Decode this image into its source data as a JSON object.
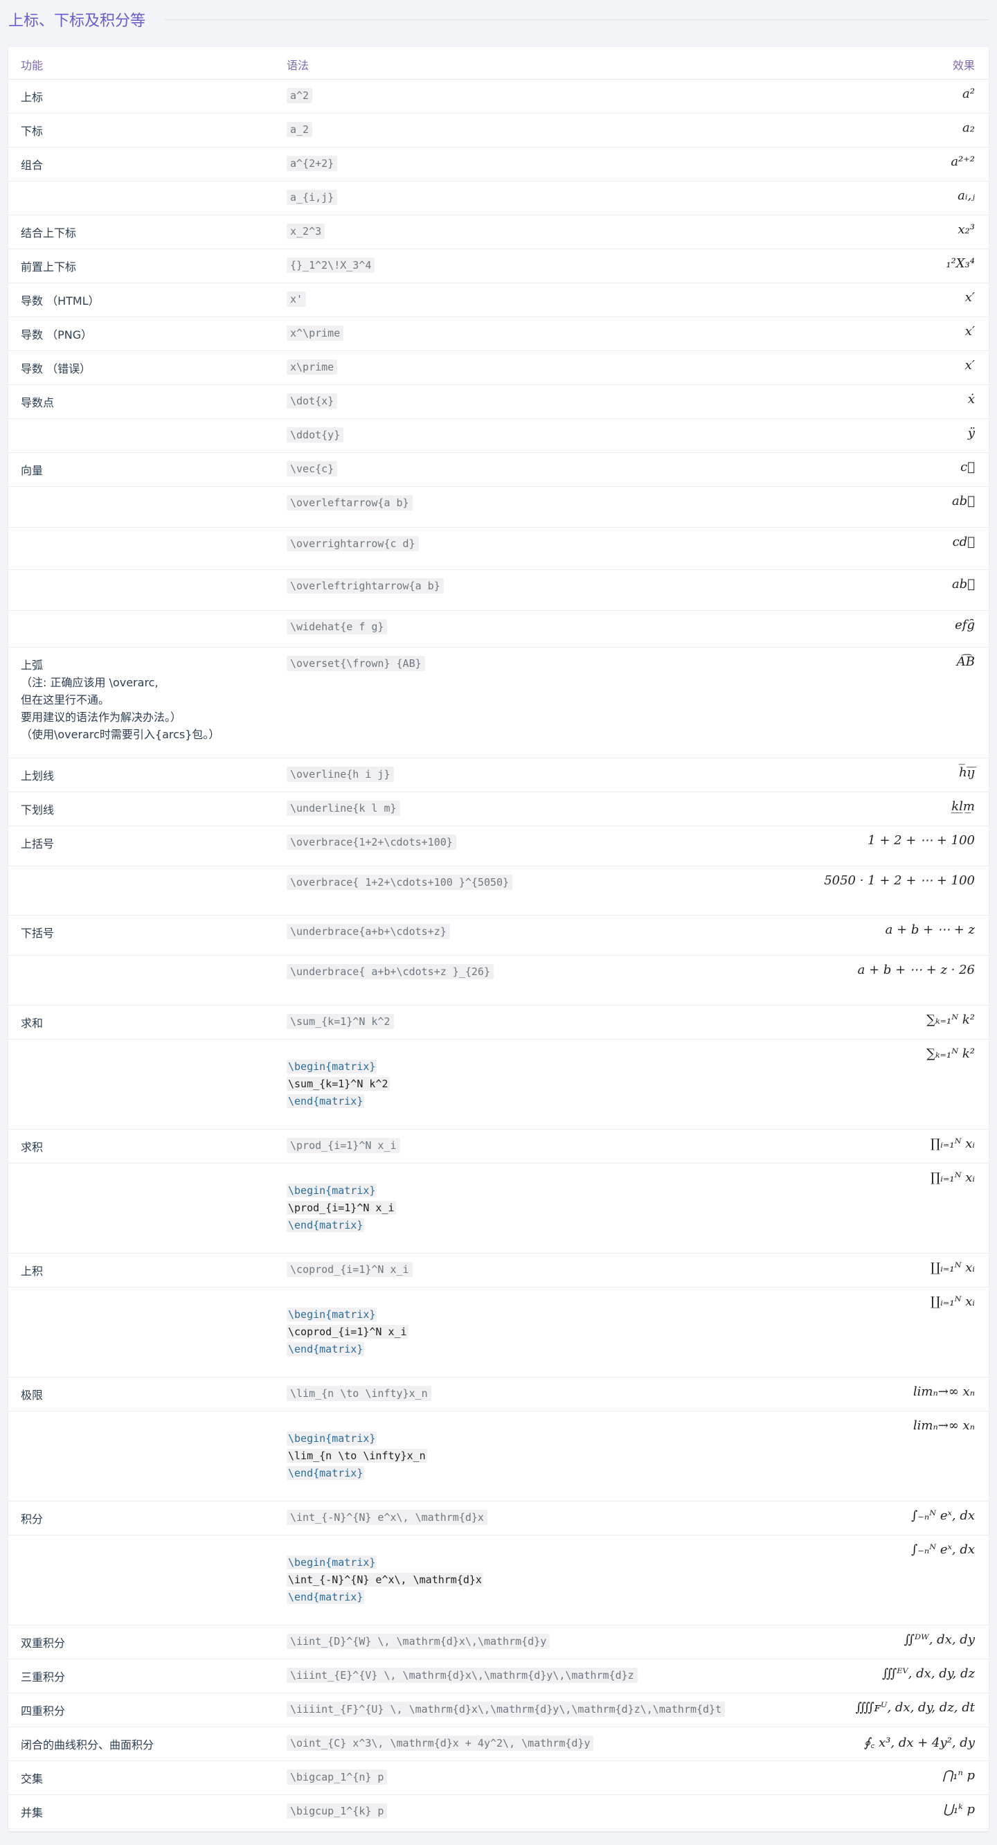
{
  "section_title": "上标、下标及积分等",
  "columns": {
    "feature": "功能",
    "syntax": "语法",
    "effect": "效果"
  },
  "rows": [
    {
      "h": 49,
      "feature": "上标",
      "syntax": "a^2",
      "effect": "a²"
    },
    {
      "h": 49,
      "feature": "下标",
      "syntax": "a_2",
      "effect": "a₂"
    },
    {
      "h": 49,
      "feature": "组合",
      "syntax": "a^{2+2}",
      "effect": "a²⁺²"
    },
    {
      "h": 49,
      "feature": "",
      "syntax": "a_{i,j}",
      "effect": "aᵢ,ⱼ"
    },
    {
      "h": 49,
      "feature": "结合上下标",
      "syntax": "x_2^3",
      "effect": "x₂³"
    },
    {
      "h": 49,
      "feature": "前置上下标",
      "syntax": "{}_1^2\\!X_3^4",
      "effect": "₁²X₃⁴"
    },
    {
      "h": 49,
      "feature": "导数 （HTML）",
      "syntax": "x'",
      "effect": "x′"
    },
    {
      "h": 49,
      "feature": "导数 （PNG）",
      "syntax": "x^\\prime",
      "effect": "x′"
    },
    {
      "h": 49,
      "feature": "导数 （错误）",
      "syntax": "x\\prime",
      "effect": "x′"
    },
    {
      "h": 49,
      "feature": "导数点",
      "syntax": "\\dot{x}",
      "effect": "ẋ"
    },
    {
      "h": 49,
      "feature": "",
      "syntax": "\\ddot{y}",
      "effect": "ÿ"
    },
    {
      "h": 49,
      "feature": "向量",
      "syntax": "\\vec{c}",
      "effect": "c⃗"
    },
    {
      "h": 59,
      "feature": "",
      "syntax": "\\overleftarrow{a b}",
      "effect": "ab⃖"
    },
    {
      "h": 61,
      "feature": "",
      "syntax": "\\overrightarrow{c d}",
      "effect": "cd⃗"
    },
    {
      "h": 59,
      "feature": "",
      "syntax": "\\overleftrightarrow{a b}",
      "effect": "ab⃡"
    },
    {
      "h": 53,
      "feature": "",
      "syntax": "\\widehat{e f g}",
      "effect": "efg̑"
    },
    {
      "h": 160,
      "feature": "上弧\n（注: 正确应该用 \\overarc,\n但在这里行不通。\n要用建议的语法作为解决办法。）\n（使用\\overarc时需要引入{arcs}包。）",
      "syntax": "\\overset{\\frown} {AB}",
      "effect": "A͡B"
    },
    {
      "h": 49,
      "feature": "上划线",
      "syntax": "\\overline{h i j}",
      "effect": "h̅i̅j̅"
    },
    {
      "h": 49,
      "feature": "下划线",
      "syntax": "\\underline{k l m}",
      "effect": "k̲l̲m̲"
    },
    {
      "h": 58,
      "feature": "上括号",
      "syntax": "\\overbrace{1+2+\\cdots+100}",
      "effect": "1 + 2 + ⋯ + 100"
    },
    {
      "h": 71,
      "feature": "",
      "syntax": "\\overbrace{ 1+2+\\cdots+100 }^{5050}",
      "effect": "5050 · 1 + 2 + ⋯ + 100"
    },
    {
      "h": 58,
      "feature": "下括号",
      "syntax": "\\underbrace{a+b+\\cdots+z}",
      "effect": "a + b + ⋯ + z"
    },
    {
      "h": 72,
      "feature": "",
      "syntax": "\\underbrace{ a+b+\\cdots+z }_{26}",
      "effect": "a + b + ⋯ + z · 26"
    },
    {
      "h": 49,
      "feature": "求和",
      "syntax": "\\sum_{k=1}^N k^2",
      "effect": "∑ₖ₌₁ᴺ k²"
    },
    {
      "h": 130,
      "feature": "",
      "syntax_block": [
        "\\begin{matrix}",
        "\\sum_{k=1}^N k^2",
        "\\end{matrix}"
      ],
      "effect": "∑ₖ₌₁ᴺ k²"
    },
    {
      "h": 49,
      "feature": "求积",
      "syntax": "\\prod_{i=1}^N x_i",
      "effect": "∏ᵢ₌₁ᴺ xᵢ"
    },
    {
      "h": 130,
      "feature": "",
      "syntax_block": [
        "\\begin{matrix}",
        "\\prod_{i=1}^N x_i",
        "\\end{matrix}"
      ],
      "effect": "∏ᵢ₌₁ᴺ xᵢ"
    },
    {
      "h": 49,
      "feature": "上积",
      "syntax": "\\coprod_{i=1}^N x_i",
      "effect": "∐ᵢ₌₁ᴺ xᵢ"
    },
    {
      "h": 130,
      "feature": "",
      "syntax_block": [
        "\\begin{matrix}",
        "\\coprod_{i=1}^N x_i",
        "\\end{matrix}"
      ],
      "effect": "∐ᵢ₌₁ᴺ xᵢ"
    },
    {
      "h": 49,
      "feature": "极限",
      "syntax": "\\lim_{n \\to \\infty}x_n",
      "effect": "limₙ→∞ xₙ"
    },
    {
      "h": 130,
      "feature": "",
      "syntax_block": [
        "\\begin{matrix}",
        "\\lim_{n \\to \\infty}x_n",
        "\\end{matrix}"
      ],
      "effect": "limₙ→∞ xₙ"
    },
    {
      "h": 49,
      "feature": "积分",
      "syntax": "\\int_{-N}^{N} e^x\\, \\mathrm{d}x",
      "effect": "∫₋ₙᴺ eˣ, dx"
    },
    {
      "h": 130,
      "feature": "",
      "syntax_block": [
        "\\begin{matrix}",
        "\\int_{-N}^{N} e^x\\, \\mathrm{d}x",
        "\\end{matrix}"
      ],
      "effect": "∫₋ₙᴺ eˣ, dx"
    },
    {
      "h": 49,
      "feature": "双重积分",
      "syntax": "\\iint_{D}^{W} \\, \\mathrm{d}x\\,\\mathrm{d}y",
      "effect": "∬ᴰᵂ, dx, dy"
    },
    {
      "h": 49,
      "feature": "三重积分",
      "syntax": "\\iiint_{E}^{V} \\, \\mathrm{d}x\\,\\mathrm{d}y\\,\\mathrm{d}z",
      "effect": "∭ᴱⱽ, dx, dy, dz"
    },
    {
      "h": 49,
      "feature": "四重积分",
      "syntax": "\\iiiint_{F}^{U} \\, \\mathrm{d}x\\,\\mathrm{d}y\\,\\mathrm{d}z\\,\\mathrm{d}t",
      "effect": "⨌ꜰᵁ, dx, dy, dz, dt"
    },
    {
      "h": 49,
      "feature": "闭合的曲线积分、曲面积分",
      "syntax": "\\oint_{C} x^3\\, \\mathrm{d}x + 4y^2\\, \\mathrm{d}y",
      "effect": "∮꜀ x³, dx + 4y², dy"
    },
    {
      "h": 49,
      "feature": "交集",
      "syntax": "\\bigcap_1^{n} p",
      "effect": "⋂₁ⁿ p"
    },
    {
      "h": 49,
      "feature": "并集",
      "syntax": "\\bigcup_1^{k} p",
      "effect": "⋃₁ᵏ p"
    }
  ]
}
